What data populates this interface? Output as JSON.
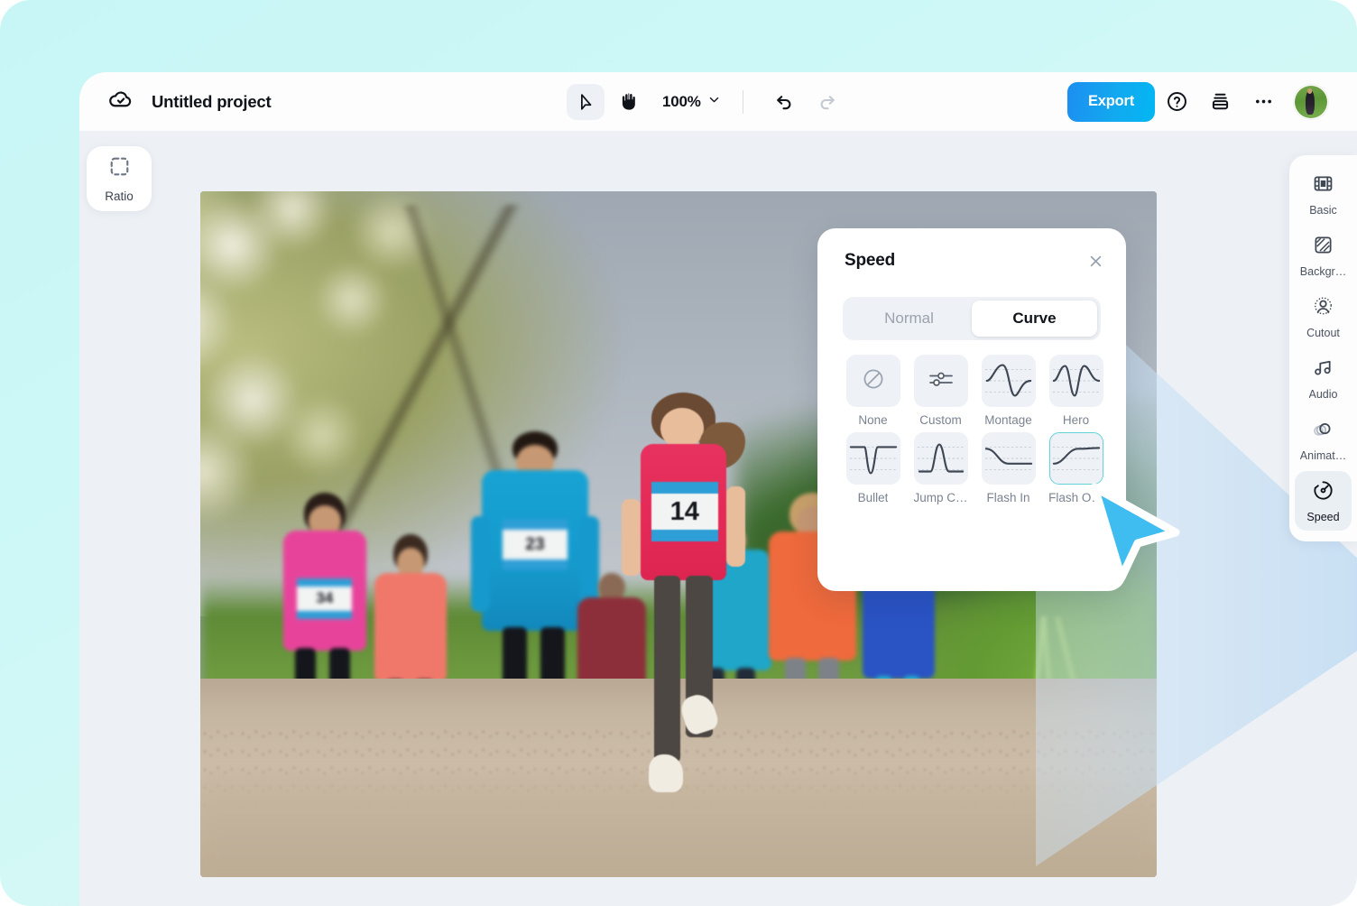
{
  "app": {
    "title": "Untitled project",
    "cloud_icon": "cloud-check-icon"
  },
  "toolbar": {
    "select_tool": "select-tool",
    "hand_tool": "hand-tool",
    "zoom_level": "100%",
    "zoom_caret": "chevron-down-icon",
    "undo": "undo-icon",
    "redo": "redo-icon",
    "export_label": "Export",
    "help": "help-circle-icon",
    "layers": "layers-icon",
    "more": "more-horizontal-icon",
    "avatar": "user-avatar"
  },
  "left_rail": {
    "ratio_label": "Ratio",
    "ratio_icon": "dashed-square-icon"
  },
  "canvas": {
    "photo_alt": "Runners racing on a dirt path",
    "bibs": [
      "14",
      "23",
      "34"
    ]
  },
  "panel": {
    "title": "Speed",
    "close_icon": "close-icon",
    "modes": [
      {
        "label": "Normal",
        "selected": false
      },
      {
        "label": "Curve",
        "selected": true
      }
    ],
    "presets": [
      {
        "label": "None",
        "icon": "no-curve-icon",
        "selected": false
      },
      {
        "label": "Custom",
        "icon": "sliders-icon",
        "selected": false
      },
      {
        "label": "Montage",
        "icon": "montage-curve-icon",
        "selected": false
      },
      {
        "label": "Hero",
        "icon": "hero-curve-icon",
        "selected": false
      },
      {
        "label": "Bullet",
        "icon": "bullet-curve-icon",
        "selected": false
      },
      {
        "label": "Jump C…",
        "icon": "jump-cut-curve-icon",
        "selected": false
      },
      {
        "label": "Flash In",
        "icon": "flash-in-curve-icon",
        "selected": false
      },
      {
        "label": "Flash O…",
        "icon": "flash-out-curve-icon",
        "selected": true
      }
    ]
  },
  "sidebar": {
    "items": [
      {
        "label": "Basic",
        "icon": "film-icon",
        "active": false
      },
      {
        "label": "Backgr…",
        "icon": "background-pattern-icon",
        "active": false
      },
      {
        "label": "Cutout",
        "icon": "cutout-person-icon",
        "active": false
      },
      {
        "label": "Audio",
        "icon": "music-notes-icon",
        "active": false
      },
      {
        "label": "Animat…",
        "icon": "animation-circles-icon",
        "active": false
      },
      {
        "label": "Speed",
        "icon": "speedometer-icon",
        "active": true
      }
    ]
  },
  "cursor": {
    "icon": "arrow-cursor"
  },
  "colors": {
    "page_background": "#ccf7f7",
    "app_background": "#edf1f5",
    "toolbar_background": "#fdfdfd",
    "accent_export_from": "#1c8ef0",
    "accent_export_to": "#03b7f3",
    "selection_border": "#63d3da",
    "cursor_fill": "#3fbcf0",
    "text_primary": "#10131a",
    "text_muted": "#7b8391"
  }
}
